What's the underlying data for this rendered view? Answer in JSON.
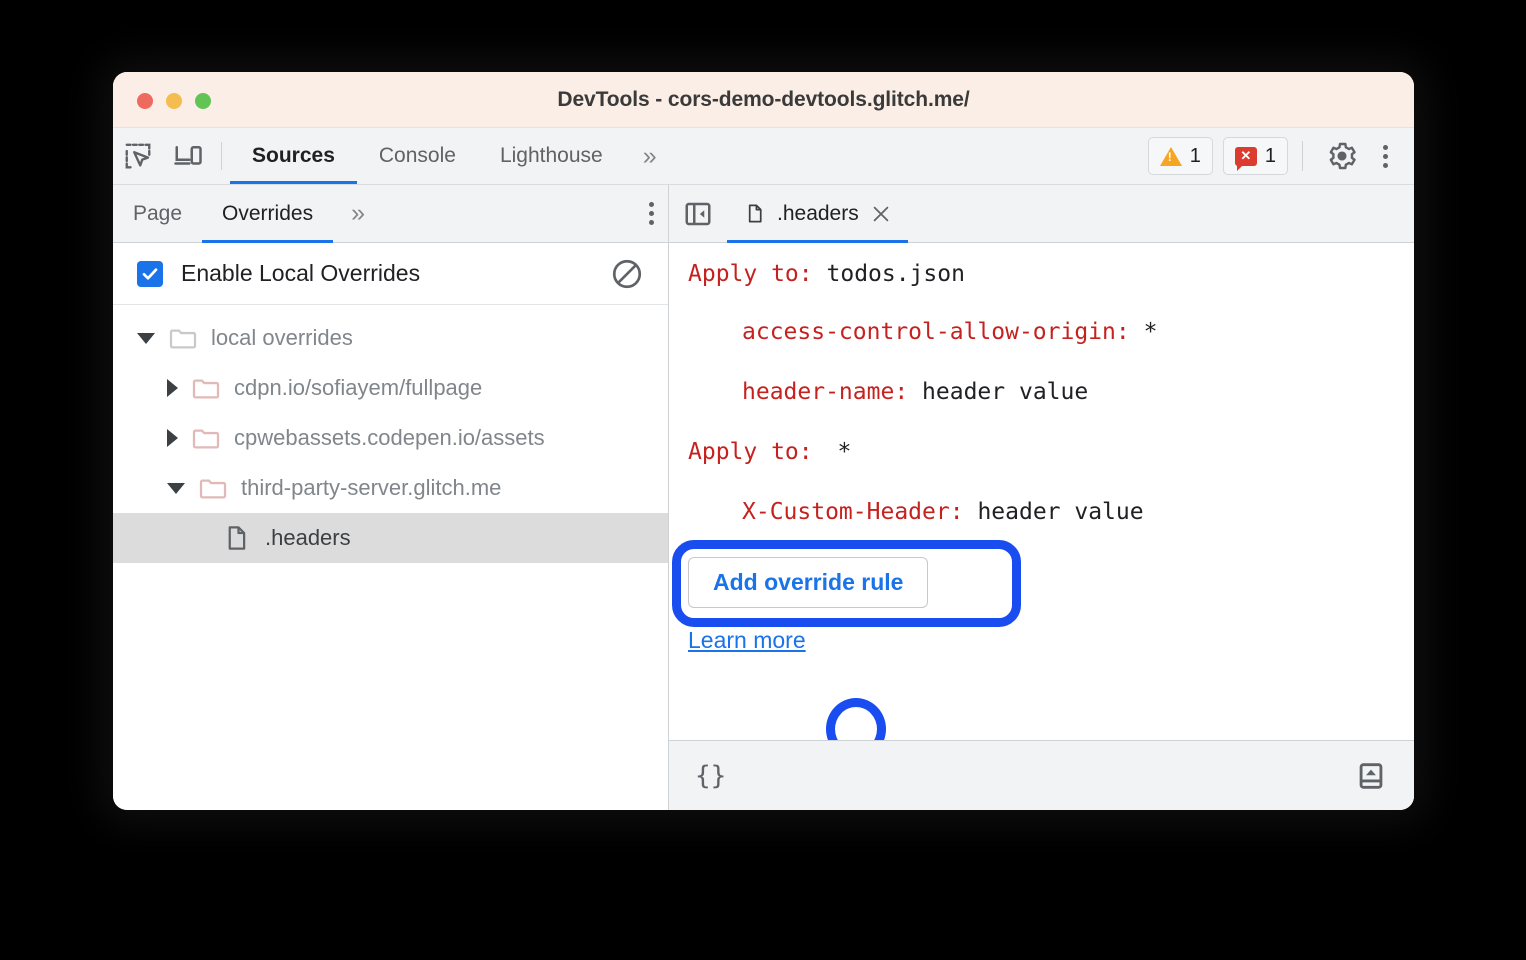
{
  "window": {
    "title": "DevTools - cors-demo-devtools.glitch.me/",
    "traffic_lights": [
      "close-red",
      "minimize-yellow",
      "maximize-green"
    ]
  },
  "toolbar": {
    "inspect_icon": "inspect-element-icon",
    "device_icon": "device-toolbar-icon",
    "panels": [
      {
        "label": "Sources",
        "active": true
      },
      {
        "label": "Console",
        "active": false
      },
      {
        "label": "Lighthouse",
        "active": false
      }
    ],
    "more_panels_label": "»",
    "warnings_count": "1",
    "errors_count": "1",
    "settings_icon": "gear-icon",
    "menu_icon": "kebab-menu-icon"
  },
  "navigator": {
    "tabs": [
      {
        "label": "Page",
        "active": false
      },
      {
        "label": "Overrides",
        "active": true
      }
    ],
    "more_tabs_label": "»",
    "menu_icon": "kebab-menu-icon",
    "enable_overrides": {
      "label": "Enable Local Overrides",
      "checked": true,
      "clear_icon": "clear-configuration-icon"
    },
    "tree": [
      {
        "label": "local overrides",
        "type": "folder",
        "expanded": true,
        "depth": 0,
        "selected": false
      },
      {
        "label": "cdpn.io/sofiayem/fullpage",
        "type": "folder",
        "expanded": false,
        "depth": 1,
        "selected": false
      },
      {
        "label": "cpwebassets.codepen.io/assets",
        "type": "folder",
        "expanded": false,
        "depth": 1,
        "selected": false
      },
      {
        "label": "third-party-server.glitch.me",
        "type": "folder",
        "expanded": true,
        "depth": 1,
        "selected": false
      },
      {
        "label": ".headers",
        "type": "file",
        "expanded": null,
        "depth": 2,
        "selected": true
      }
    ]
  },
  "editor": {
    "collapse_icon": "collapse-sidebar-icon",
    "tab": {
      "label": ".headers",
      "file_icon": "file-icon",
      "close_icon": "close-icon"
    },
    "headers_rules": [
      {
        "apply_to_label": "Apply to",
        "apply_to_value": "todos.json",
        "headers": [
          {
            "name": "access-control-allow-origin",
            "value": "*"
          },
          {
            "name": "header-name",
            "value": "header value"
          }
        ]
      },
      {
        "apply_to_label": "Apply to",
        "apply_to_value": "*",
        "headers": [
          {
            "name": "X-Custom-Header",
            "value": "header value"
          }
        ]
      }
    ],
    "row_actions": {
      "add_icon": "plus-icon",
      "delete_icon": "trash-icon"
    },
    "add_rule_label": "Add override rule",
    "learn_more_label": "Learn more",
    "highlight_color": "#1a4df0"
  },
  "status_bar": {
    "pretty_print_label": "{}",
    "pretty_print_icon": "format-braces-icon",
    "drawer_icon": "show-drawer-icon"
  }
}
